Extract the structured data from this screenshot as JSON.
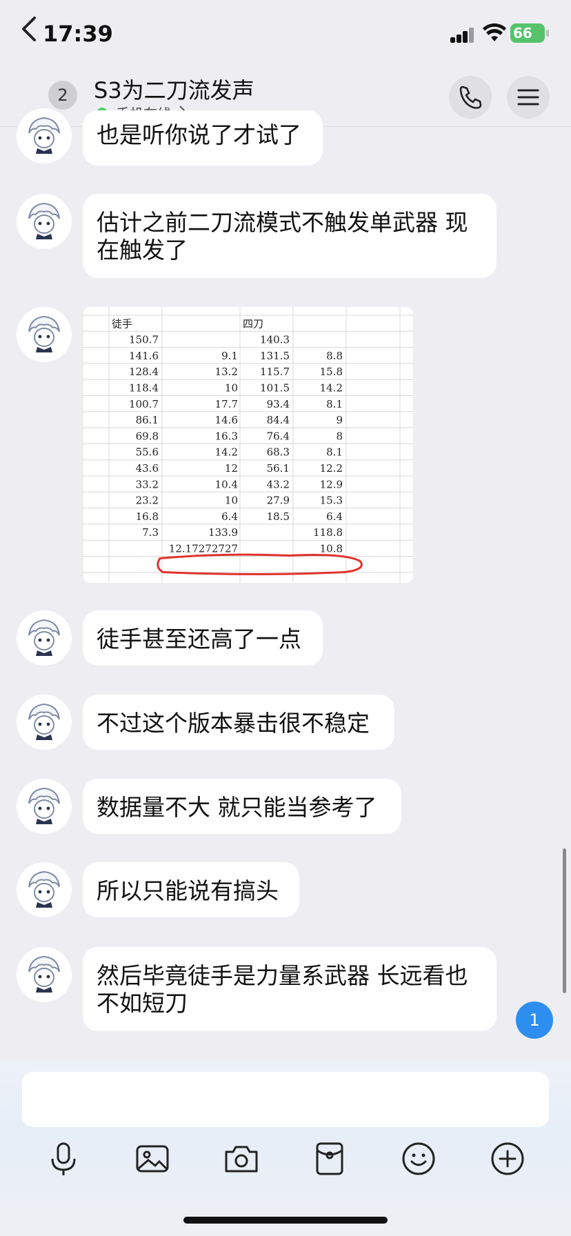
{
  "status_bar": {
    "time": "17:39",
    "battery": "66"
  },
  "header": {
    "unread_count": "2",
    "title": "S3为二刀流发声",
    "online_status": "手机在线"
  },
  "messages": [
    {
      "type": "text",
      "text": "也是听你说了才试了"
    },
    {
      "type": "text",
      "text": "估计之前二刀流模式不触发单武器 现在触发了"
    },
    {
      "type": "image",
      "description": "spreadsheet"
    },
    {
      "type": "text",
      "text": "徒手甚至还高了一点"
    },
    {
      "type": "text",
      "text": "不过这个版本暴击很不稳定"
    },
    {
      "type": "text",
      "text": "数据量不大 就只能当参考了"
    },
    {
      "type": "text",
      "text": "所以只能说有搞头"
    },
    {
      "type": "text",
      "text": "然后毕竟徒手是力量系武器 长远看也不如短刀"
    }
  ],
  "spreadsheet": {
    "header": [
      "徒手",
      "",
      "四刀",
      ""
    ],
    "rows": [
      [
        "150.7",
        "",
        "140.3",
        ""
      ],
      [
        "141.6",
        "9.1",
        "131.5",
        "8.8"
      ],
      [
        "128.4",
        "13.2",
        "115.7",
        "15.8"
      ],
      [
        "118.4",
        "10",
        "101.5",
        "14.2"
      ],
      [
        "100.7",
        "17.7",
        "93.4",
        "8.1"
      ],
      [
        "86.1",
        "14.6",
        "84.4",
        "9"
      ],
      [
        "69.8",
        "16.3",
        "76.4",
        "8"
      ],
      [
        "55.6",
        "14.2",
        "68.3",
        "8.1"
      ],
      [
        "43.6",
        "12",
        "56.1",
        "12.2"
      ],
      [
        "33.2",
        "10.4",
        "43.2",
        "12.9"
      ],
      [
        "23.2",
        "10",
        "27.9",
        "15.3"
      ],
      [
        "16.8",
        "6.4",
        "18.5",
        "6.4"
      ],
      [
        "7.3",
        "133.9",
        "",
        "118.8"
      ],
      [
        "",
        "12.17272727",
        "",
        "10.8"
      ]
    ]
  },
  "new_message_count": "1",
  "colors": {
    "accent": "#2d8ef0",
    "online": "#4ed06c",
    "annotation": "#e0322e"
  }
}
